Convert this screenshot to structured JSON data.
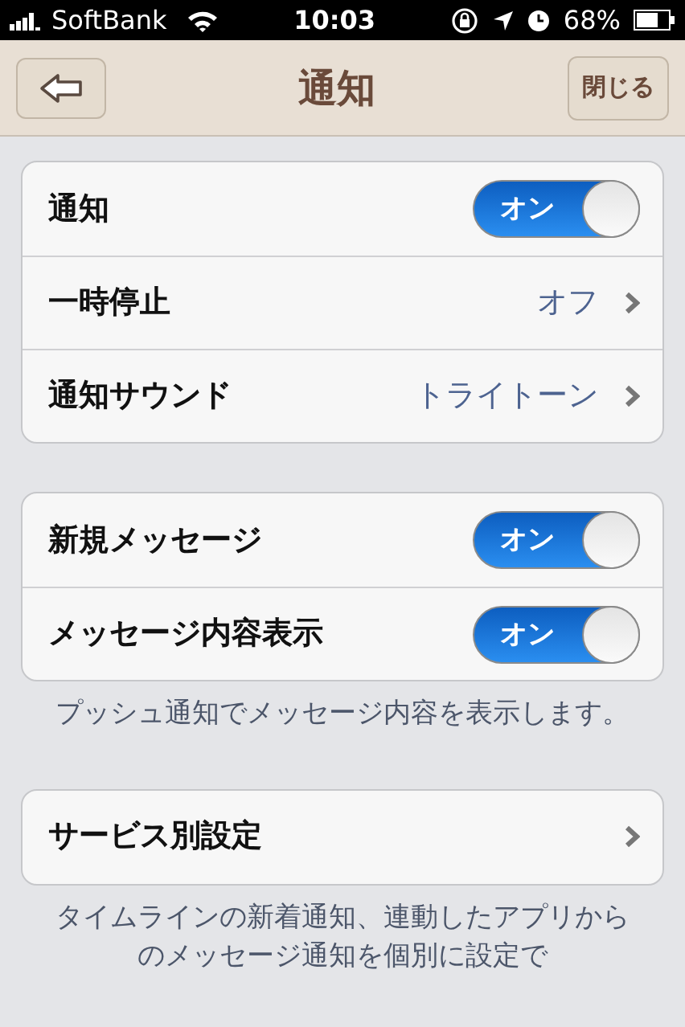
{
  "status_bar": {
    "carrier": "SoftBank",
    "time": "10:03",
    "battery": "68%"
  },
  "nav_bar": {
    "title": "通知",
    "close_button": "閉じる"
  },
  "groups": [
    {
      "rows": [
        {
          "kind": "toggle",
          "label": "通知",
          "on": true,
          "switch_label": "オン"
        },
        {
          "kind": "link",
          "label": "一時停止",
          "value": "オフ"
        },
        {
          "kind": "link",
          "label": "通知サウンド",
          "value": "トライトーン"
        }
      ]
    },
    {
      "rows": [
        {
          "kind": "toggle",
          "label": "新規メッセージ",
          "on": true,
          "switch_label": "オン"
        },
        {
          "kind": "toggle",
          "label": "メッセージ内容表示",
          "on": true,
          "switch_label": "オン"
        }
      ],
      "footer": "プッシュ通知でメッセージ内容を表示します。"
    },
    {
      "rows": [
        {
          "kind": "link",
          "label": "サービス別設定"
        }
      ],
      "footer": "タイムラインの新着通知、連動したアプリからのメッセージ通知を個別に設定で"
    }
  ]
}
